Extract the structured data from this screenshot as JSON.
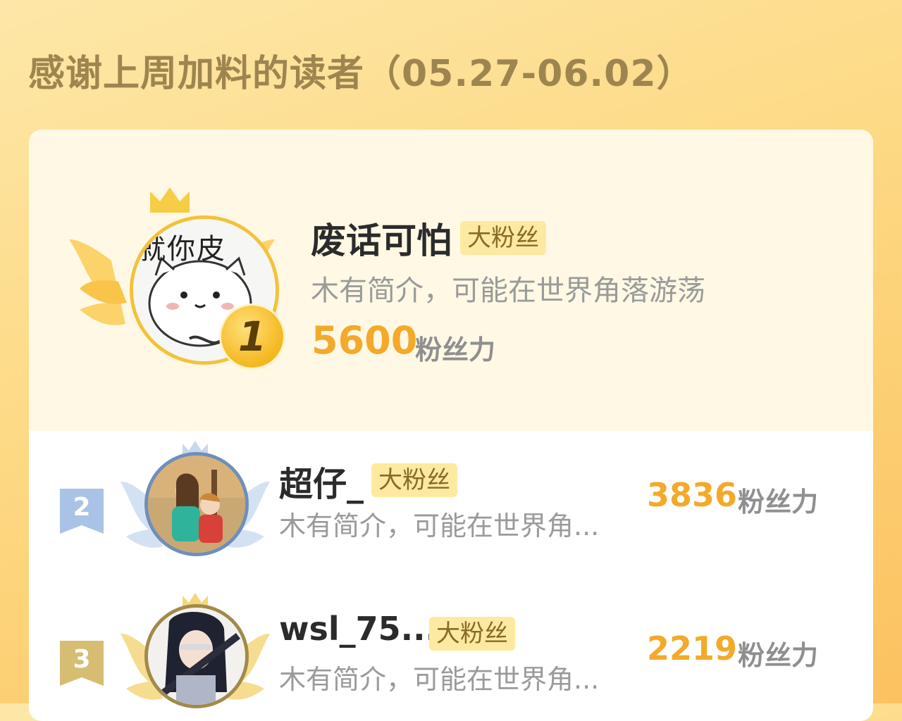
{
  "title": "感谢上周加料的读者（05.27-06.02）",
  "fan_badge": "大粉丝",
  "score_unit": "粉丝力",
  "top_reader": {
    "rank": "1",
    "name": "废话可怕",
    "bio": "木有简介，可能在世界角落游荡",
    "score": "5600",
    "avatar_caption": "就你皮"
  },
  "readers": [
    {
      "rank": "2",
      "name": "超仔_",
      "bio": "木有简介，可能在世界角...",
      "score": "3836"
    },
    {
      "rank": "3",
      "name": "wsl_75...",
      "bio": "木有简介，可能在世界角...",
      "score": "2219"
    }
  ],
  "colors": {
    "accent_score": "#f3a92a",
    "title": "#9e8550",
    "badge_bg": "#fdeaa0",
    "silver_ring": "#6f8fb8",
    "bronze_ring": "#a18a4a",
    "gold_ring": "#f3c23a"
  }
}
